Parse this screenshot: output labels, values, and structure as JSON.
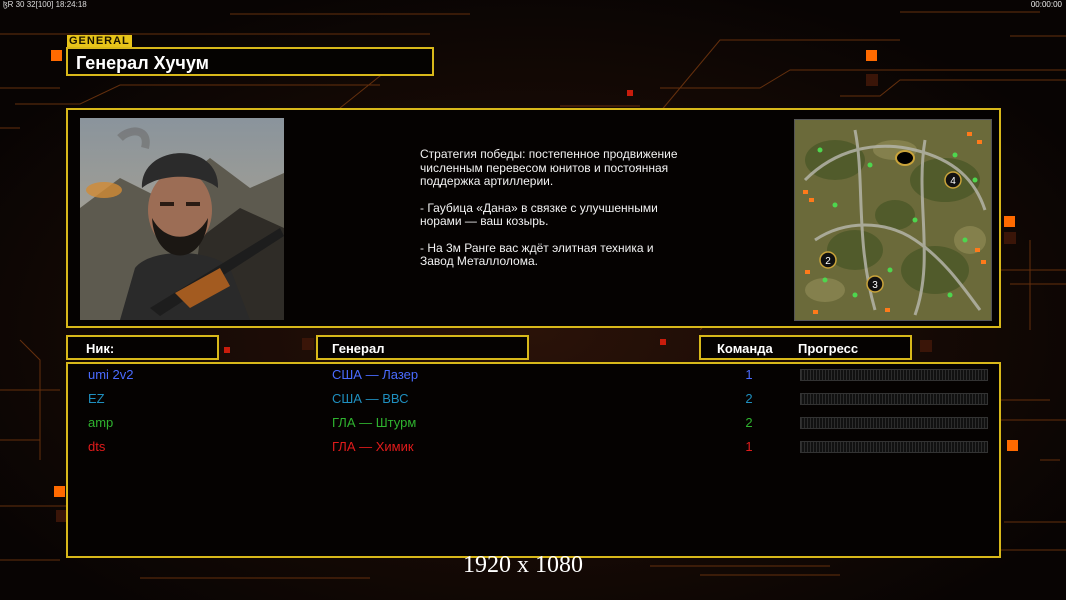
{
  "topbar": {
    "stats_left": "ɮR 30 32[100] 18:24:18",
    "clock_right": "00:00:00"
  },
  "header": {
    "tag": "GENERAL",
    "general_name": "Генерал Хучум"
  },
  "briefing": {
    "strategy": "Стратегия победы: постепенное продвижение численным перевесом юнитов и постоянная поддержка артиллерии.",
    "tip1": "- Гаубица «Дана» в связке с улучшенными норами — ваш козырь.",
    "tip2": "- На 3м Ранге вас ждёт элитная техника и Завод Металлолома."
  },
  "map": {
    "start_positions": [
      "2",
      "3",
      "4"
    ]
  },
  "columns": {
    "nick": "Ник:",
    "general": "Генерал",
    "team": "Команда",
    "progress": "Прогресс"
  },
  "players": [
    {
      "nick": "umi 2v2",
      "general": "США — Лазер",
      "team": "1",
      "color": "#4a6bff",
      "progress": 0
    },
    {
      "nick": "EZ",
      "general": "США — ВВС",
      "team": "2",
      "color": "#1f8fbf",
      "progress": 0
    },
    {
      "nick": "amp",
      "general": "ГЛА — Штурм",
      "team": "2",
      "color": "#2fb32f",
      "progress": 0
    },
    {
      "nick": "dts",
      "general": "ГЛА — Химик",
      "team": "1",
      "color": "#e01b1b",
      "progress": 0
    }
  ],
  "footer": {
    "resolution": "1920 x 1080"
  },
  "colors": {
    "frame": "#d8b81a",
    "accent_orange": "#ff7a10"
  }
}
